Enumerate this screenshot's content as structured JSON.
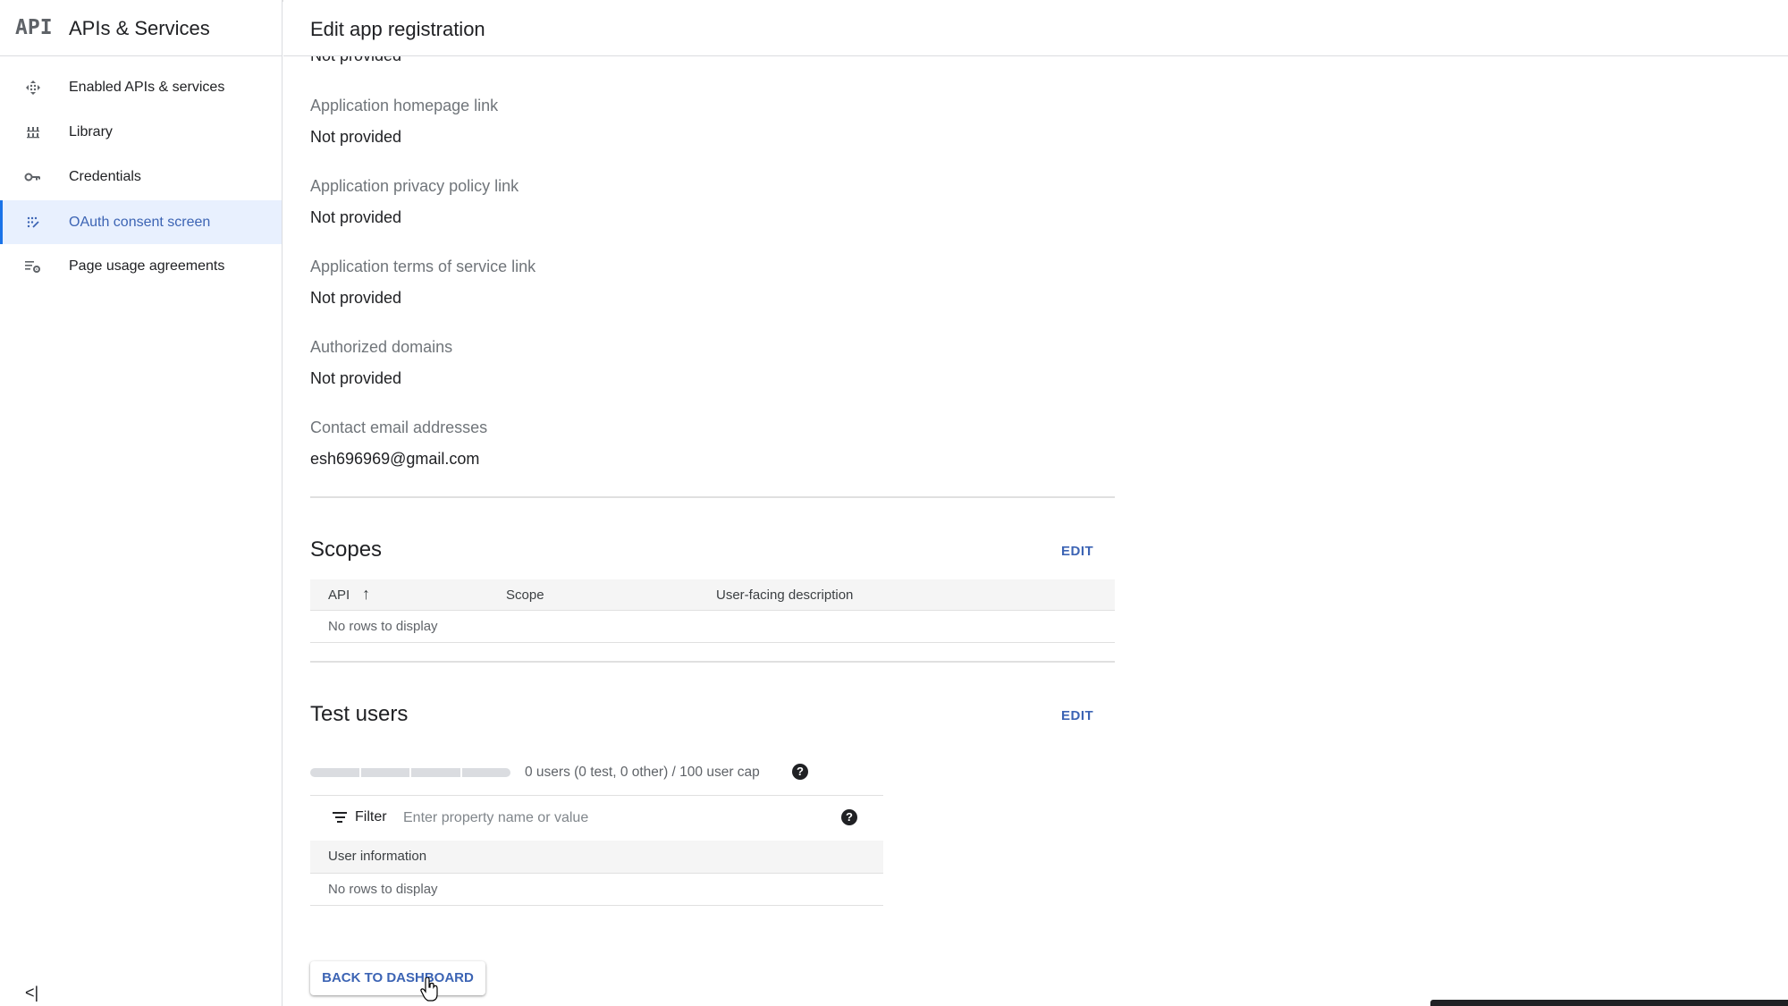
{
  "sidebar": {
    "logo": "API",
    "title": "APIs & Services",
    "items": [
      {
        "label": "Enabled APIs & services",
        "icon": "enabled-apis-icon"
      },
      {
        "label": "Library",
        "icon": "library-icon"
      },
      {
        "label": "Credentials",
        "icon": "key-icon"
      },
      {
        "label": "OAuth consent screen",
        "icon": "oauth-consent-icon",
        "active": true
      },
      {
        "label": "Page usage agreements",
        "icon": "settings-list-icon"
      }
    ],
    "collapse": "<|"
  },
  "header": {
    "title": "Edit app registration"
  },
  "app_info": {
    "cut_value": "Not provided",
    "fields": [
      {
        "label": "Application homepage link",
        "value": "Not provided"
      },
      {
        "label": "Application privacy policy link",
        "value": "Not provided"
      },
      {
        "label": "Application terms of service link",
        "value": "Not provided"
      },
      {
        "label": "Authorized domains",
        "value": "Not provided"
      },
      {
        "label": "Contact email addresses",
        "value": "esh696969@gmail.com"
      }
    ]
  },
  "scopes": {
    "title": "Scopes",
    "edit_label": "EDIT",
    "columns": [
      "API",
      "Scope",
      "User-facing description"
    ],
    "sort_icon": "↑",
    "empty": "No rows to display"
  },
  "test_users": {
    "title": "Test users",
    "edit_label": "EDIT",
    "usage_fraction": 0,
    "usage_text": "0 users (0 test, 0 other) / 100 user cap",
    "filter_label": "Filter",
    "filter_placeholder": "Enter property name or value",
    "filter_value": "",
    "columns": [
      "User information"
    ],
    "empty": "No rows to display"
  },
  "back_button": "BACK TO DASHBOARD",
  "colors": {
    "accent": "#3c64b4",
    "active_bg": "#e8f0fe",
    "active_bar": "#1a73e8"
  }
}
